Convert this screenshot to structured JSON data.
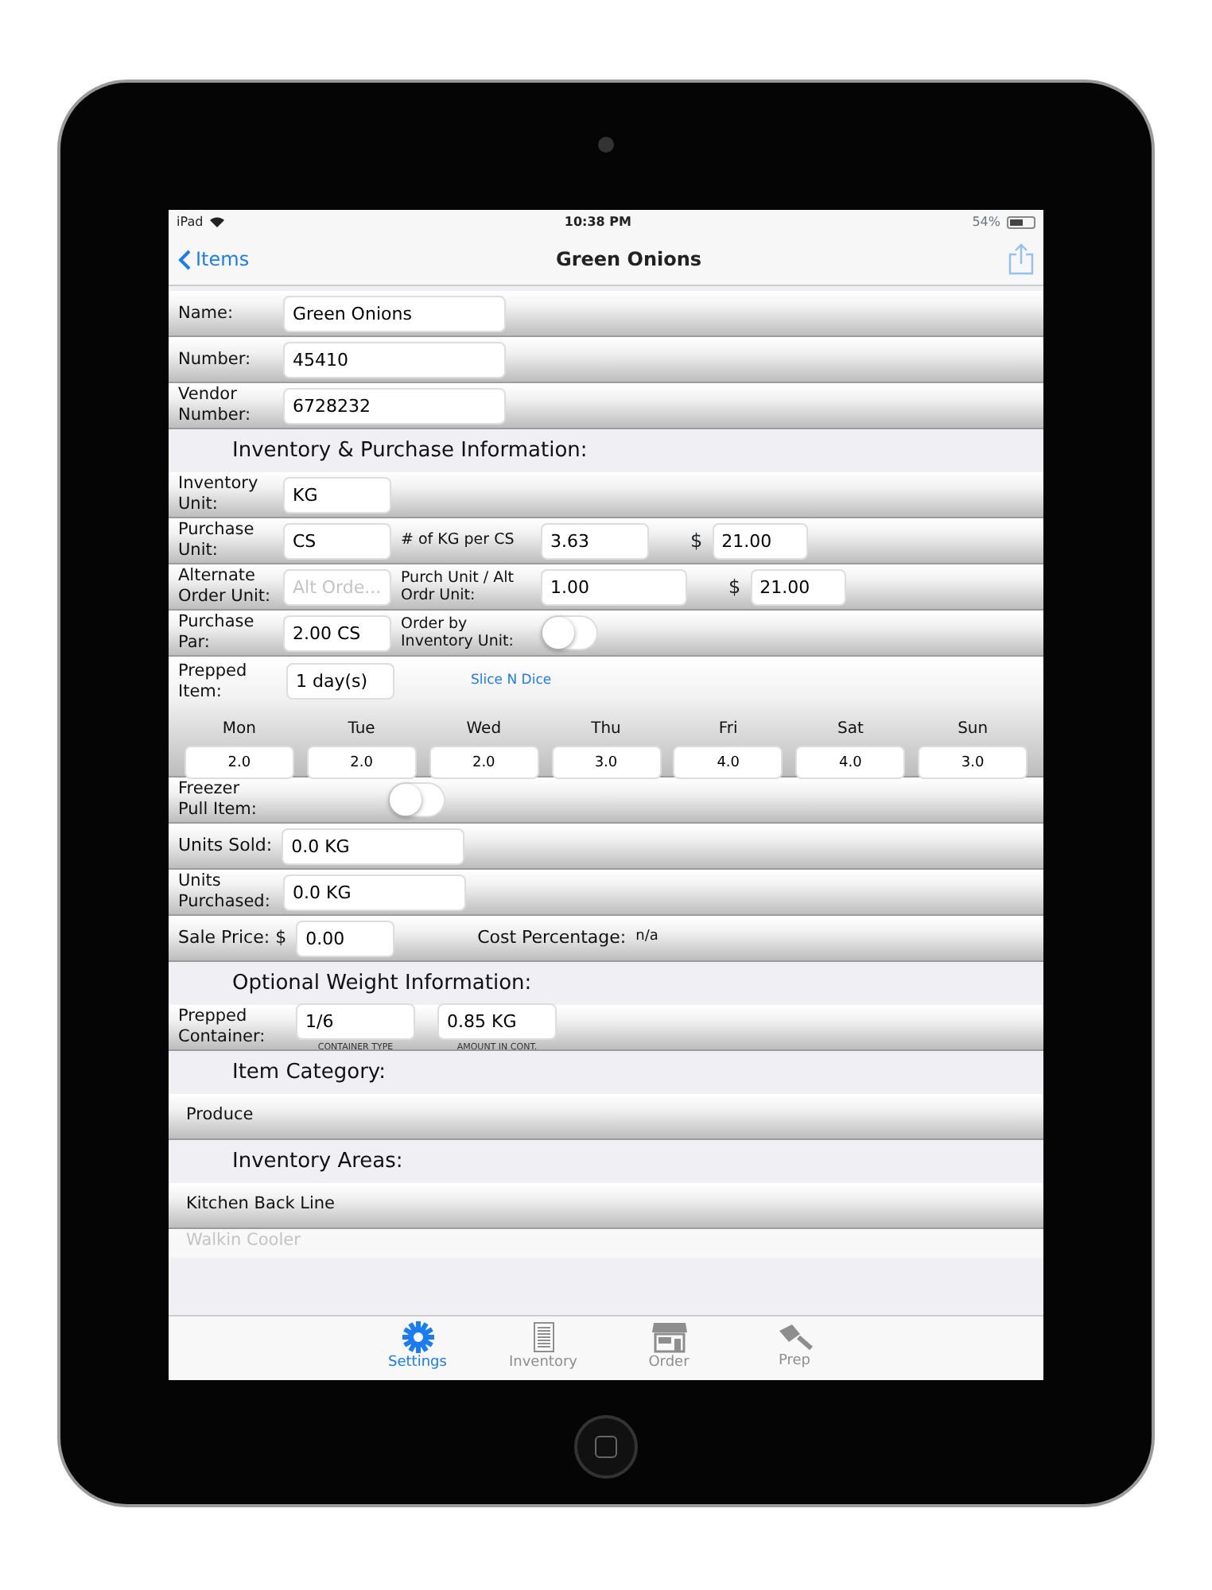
{
  "status_bar": {
    "device": "iPad",
    "time": "10:38 PM",
    "battery": "54%"
  },
  "nav": {
    "back": "Items",
    "title": "Green Onions"
  },
  "rows": [
    {
      "kind": "row",
      "items": [
        {
          "kind": "label",
          "text": "Name:"
        },
        {
          "kind": "field",
          "value": "Green Onions"
        }
      ]
    },
    {
      "kind": "row",
      "items": [
        {
          "kind": "label",
          "text": "Number:"
        },
        {
          "kind": "field",
          "value": "45410"
        }
      ]
    },
    {
      "kind": "row",
      "items": [
        {
          "kind": "label",
          "text": "Vendor Number:"
        },
        {
          "kind": "field",
          "value": "6728232"
        }
      ]
    },
    {
      "kind": "header",
      "text": "Inventory & Purchase Information:"
    },
    {
      "kind": "row",
      "items": [
        {
          "kind": "label",
          "text": "Inventory Unit:"
        },
        {
          "kind": "short_field",
          "value": "KG"
        }
      ]
    },
    {
      "kind": "row",
      "items": [
        {
          "kind": "label",
          "text": "Purchase Unit:"
        },
        {
          "kind": "short_field",
          "value": "CS"
        },
        {
          "kind": "sublabel",
          "text": "# of KG per CS"
        },
        {
          "kind": "short_field",
          "value": "3.63"
        },
        {
          "kind": "currency",
          "text": "$"
        },
        {
          "kind": "price_field",
          "value": "21.00"
        }
      ]
    },
    {
      "kind": "row",
      "items": [
        {
          "kind": "label",
          "text": "Alternate Order Unit:"
        },
        {
          "kind": "short_field",
          "placeholder": "Alt Orde..."
        },
        {
          "kind": "sublabel",
          "text": "Purch Unit / Alt Ordr Unit:"
        },
        {
          "kind": "mid_field",
          "value": "1.00"
        },
        {
          "kind": "currency",
          "text": "$"
        },
        {
          "kind": "price_field",
          "value": "21.00"
        }
      ]
    },
    {
      "kind": "row",
      "items": [
        {
          "kind": "label",
          "text": "Purchase Par:"
        },
        {
          "kind": "short_field",
          "value": "2.00 CS"
        },
        {
          "kind": "sublabel",
          "text": "Order by Inventory Unit:"
        },
        {
          "kind": "toggle",
          "on": false
        }
      ]
    },
    {
      "kind": "prepped",
      "items": [
        {
          "kind": "label",
          "text": "Prepped Item:"
        },
        {
          "kind": "short_field",
          "value": "1 day(s)"
        },
        {
          "kind": "link",
          "text": "Slice N Dice"
        }
      ],
      "days": [
        {
          "day": "Mon",
          "value": "2.0"
        },
        {
          "day": "Tue",
          "value": "2.0"
        },
        {
          "day": "Wed",
          "value": "2.0"
        },
        {
          "day": "Thu",
          "value": "3.0"
        },
        {
          "day": "Fri",
          "value": "4.0"
        },
        {
          "day": "Sat",
          "value": "4.0"
        },
        {
          "day": "Sun",
          "value": "3.0"
        }
      ]
    },
    {
      "kind": "row",
      "items": [
        {
          "kind": "label",
          "text": "Freezer Pull Item:"
        },
        {
          "kind": "spacer"
        },
        {
          "kind": "toggle",
          "on": false
        }
      ]
    },
    {
      "kind": "row",
      "items": [
        {
          "kind": "wide_label",
          "text": "Units Sold:"
        },
        {
          "kind": "med_field",
          "value": "0.0 KG"
        }
      ]
    },
    {
      "kind": "row",
      "items": [
        {
          "kind": "label",
          "text": "Units Purchased:"
        },
        {
          "kind": "med_field",
          "value": "0.0 KG"
        }
      ]
    },
    {
      "kind": "row",
      "items": [
        {
          "kind": "wide_label",
          "text": "Sale Price: $"
        },
        {
          "kind": "small_field",
          "value": "0.00"
        },
        {
          "kind": "gap"
        },
        {
          "kind": "sublabel_one",
          "text": "Cost Percentage:"
        },
        {
          "kind": "note",
          "text": "n/a"
        }
      ]
    },
    {
      "kind": "header",
      "text": "Optional Weight Information:"
    },
    {
      "kind": "row",
      "items": [
        {
          "kind": "label",
          "text": "Prepped Container:"
        },
        {
          "kind": "captioned_field",
          "value": "1/6",
          "caption": "CONTAINER TYPE"
        },
        {
          "kind": "captioned_field",
          "value": "0.85 KG",
          "caption": "AMOUNT IN CONT."
        }
      ]
    },
    {
      "kind": "header",
      "text": "Item Category:"
    },
    {
      "kind": "plain",
      "text": "Produce",
      "faded": false
    },
    {
      "kind": "header",
      "text": "Inventory Areas:"
    },
    {
      "kind": "plain",
      "text": "Kitchen Back Line",
      "faded": false
    },
    {
      "kind": "plain",
      "text": "Walkin Cooler",
      "faded": true
    }
  ],
  "tabs": [
    {
      "label": "Settings",
      "kind": "gear",
      "selected": true
    },
    {
      "label": "Inventory",
      "kind": "sheet",
      "selected": false
    },
    {
      "label": "Order",
      "kind": "store",
      "selected": false
    },
    {
      "label": "Prep",
      "kind": "cleaver",
      "selected": false
    }
  ]
}
